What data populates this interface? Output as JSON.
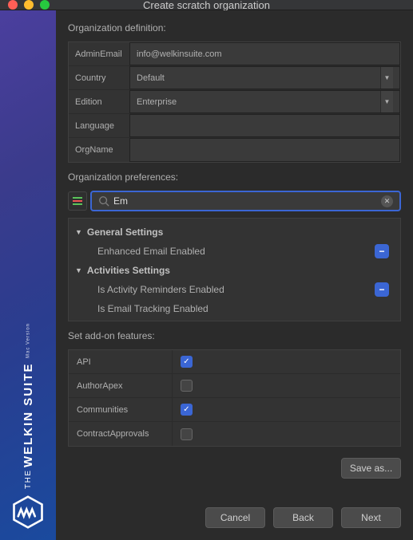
{
  "window": {
    "title": "Create scratch organization"
  },
  "brand": {
    "the": "THE",
    "name": "WELKIN SUITE",
    "sub": "Mac Version"
  },
  "org_def": {
    "section_label": "Organization definition:",
    "rows": [
      {
        "label": "AdminEmail",
        "value": "info@welkinsuite.com",
        "type": "text"
      },
      {
        "label": "Country",
        "value": "Default",
        "type": "select"
      },
      {
        "label": "Edition",
        "value": "Enterprise",
        "type": "select"
      },
      {
        "label": "Language",
        "value": "",
        "type": "text"
      },
      {
        "label": "OrgName",
        "value": "",
        "type": "text"
      }
    ]
  },
  "org_pref": {
    "section_label": "Organization preferences:",
    "search_value": "Em",
    "groups": [
      {
        "title": "General Settings",
        "items": [
          {
            "label": "Enhanced Email Enabled",
            "state": "minus"
          }
        ]
      },
      {
        "title": "Activities Settings",
        "items": [
          {
            "label": "Is Activity Reminders Enabled",
            "state": "minus"
          },
          {
            "label": "Is Email Tracking Enabled",
            "state": "minus"
          }
        ]
      }
    ]
  },
  "features": {
    "section_label": "Set add-on features:",
    "items": [
      {
        "label": "API",
        "checked": true
      },
      {
        "label": "AuthorApex",
        "checked": false
      },
      {
        "label": "Communities",
        "checked": true
      },
      {
        "label": "ContractApprovals",
        "checked": false
      }
    ]
  },
  "buttons": {
    "save_as": "Save as...",
    "cancel": "Cancel",
    "back": "Back",
    "next": "Next"
  },
  "colors": {
    "accent": "#3b66d4"
  }
}
